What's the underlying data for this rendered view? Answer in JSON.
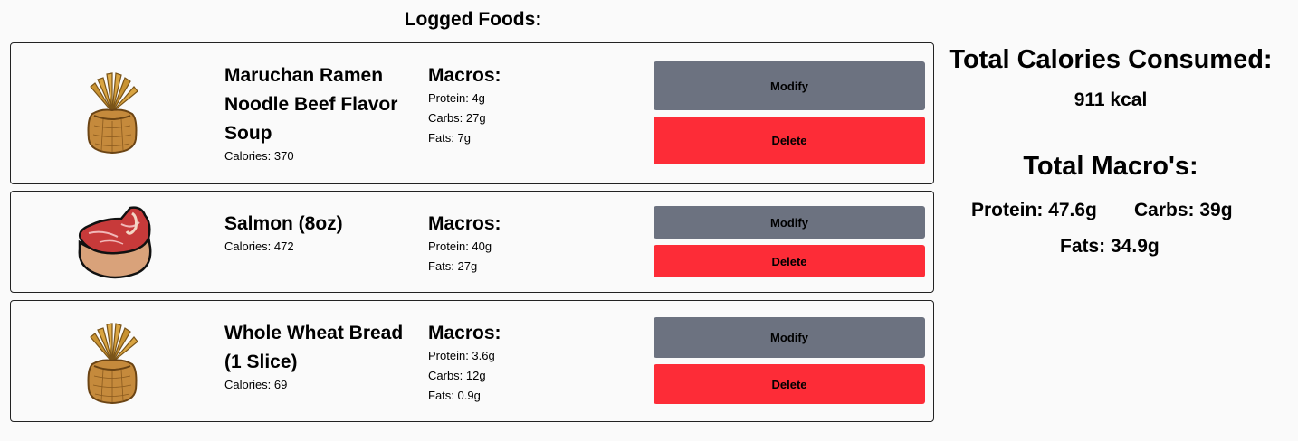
{
  "log_title": "Logged Foods:",
  "foods": [
    {
      "name": "Maruchan Ramen Noodle Beef Flavor Soup",
      "calories": "Calories: 370",
      "icon": "wheat-sack-icon",
      "macros_title": "Macros:",
      "macros": [
        "Protein: 4g",
        "Carbs: 27g",
        "Fats: 7g"
      ],
      "modify_label": "Modify",
      "delete_label": "Delete"
    },
    {
      "name": "Salmon (8oz)",
      "calories": "Calories: 472",
      "icon": "steak-icon",
      "macros_title": "Macros:",
      "macros": [
        "Protein: 40g",
        "Fats: 27g"
      ],
      "modify_label": "Modify",
      "delete_label": "Delete"
    },
    {
      "name": "Whole Wheat Bread (1 Slice)",
      "calories": "Calories: 69",
      "icon": "wheat-sack-icon",
      "macros_title": "Macros:",
      "macros": [
        "Protein: 3.6g",
        "Carbs: 12g",
        "Fats: 0.9g"
      ],
      "modify_label": "Modify",
      "delete_label": "Delete"
    }
  ],
  "summary": {
    "calories_title": "Total Calories Consumed:",
    "calories_value": "911 kcal",
    "macros_title": "Total Macro's:",
    "protein": "Protein: 47.6g",
    "carbs": "Carbs: 39g",
    "fats": "Fats: 34.9g"
  },
  "colors": {
    "modify": "#6c7280",
    "delete": "#fd2c37",
    "background": "#fafafa"
  }
}
